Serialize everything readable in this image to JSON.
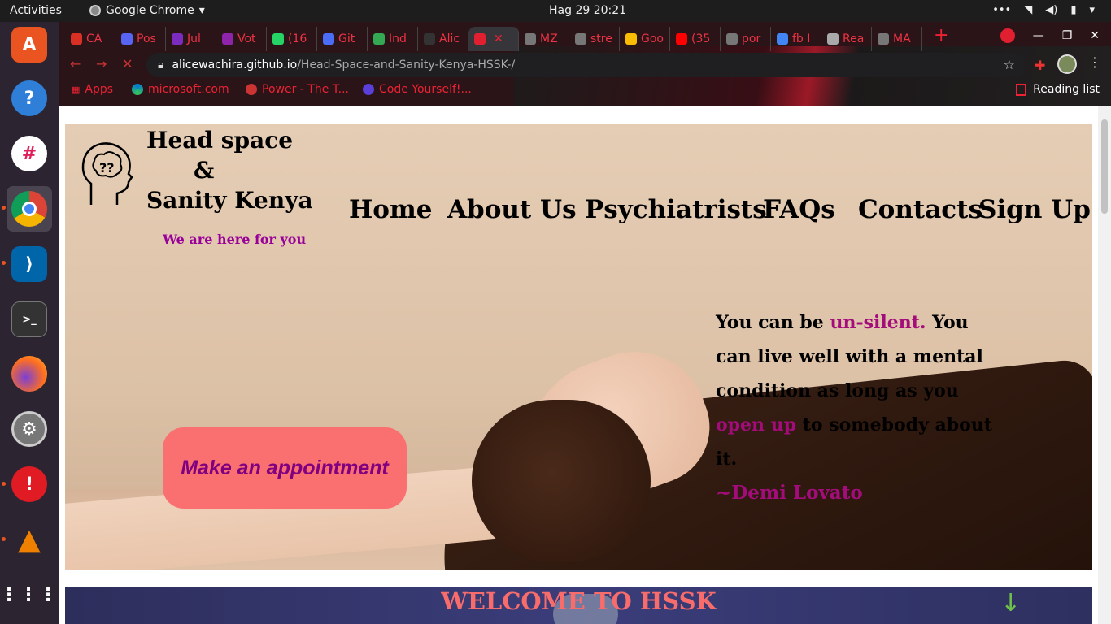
{
  "topbar": {
    "activities": "Activities",
    "app_name": "Google Chrome",
    "clock": "Hag 29  20:21"
  },
  "dock": {
    "items": [
      "ubuntu-software",
      "help",
      "slack",
      "google-chrome",
      "vscode",
      "terminal",
      "firefox",
      "settings",
      "update-notifier",
      "vlc",
      "show-apps"
    ]
  },
  "chrome": {
    "tabs": [
      {
        "label": "CA",
        "color": "#d93025"
      },
      {
        "label": "Pos",
        "color": "#5865f2"
      },
      {
        "label": "Jul",
        "color": "#7b2cbf"
      },
      {
        "label": "Vot",
        "color": "#8e24aa"
      },
      {
        "label": "(16",
        "color": "#25d366"
      },
      {
        "label": "Git",
        "color": "#4a6cf7"
      },
      {
        "label": "Ind",
        "color": "#34a853"
      },
      {
        "label": "Alic",
        "color": "#333333"
      },
      {
        "label": "",
        "color": "#e02030"
      },
      {
        "label": "MZ",
        "color": "#777777"
      },
      {
        "label": "stre",
        "color": "#777777"
      },
      {
        "label": "Goo",
        "color": "#fbbc04"
      },
      {
        "label": "(35",
        "color": "#ff0000"
      },
      {
        "label": "por",
        "color": "#777777"
      },
      {
        "label": "fb I",
        "color": "#4285f4"
      },
      {
        "label": "Rea",
        "color": "#aaaaaa"
      },
      {
        "label": "MA",
        "color": "#777777"
      }
    ],
    "address_host": "alicewachira.github.io",
    "address_path": "/Head-Space-and-Sanity-Kenya-HSSK-/",
    "bookmarks": [
      "Apps",
      "microsoft.com",
      "Power - The T...",
      "Code Yourself!..."
    ],
    "reading_list": "Reading list"
  },
  "site": {
    "title_line1": "Head space",
    "title_line2": "&",
    "title_line3": "Sanity Kenya",
    "tagline": "We are here for you",
    "nav": [
      "Home",
      "About Us",
      "Psychiatrists",
      "FAQs",
      "Contacts",
      "Sign Up"
    ],
    "appointment_button": "Make an appointment",
    "quote": {
      "p1": "You can be ",
      "hl1": "un-silent.",
      "p2": " You can live well with a mental condition as long as you ",
      "hl2": "open up",
      "p3": " to somebody about it.",
      "author": "~Demi Lovato"
    },
    "welcome": "WELCOME TO HSSK"
  }
}
